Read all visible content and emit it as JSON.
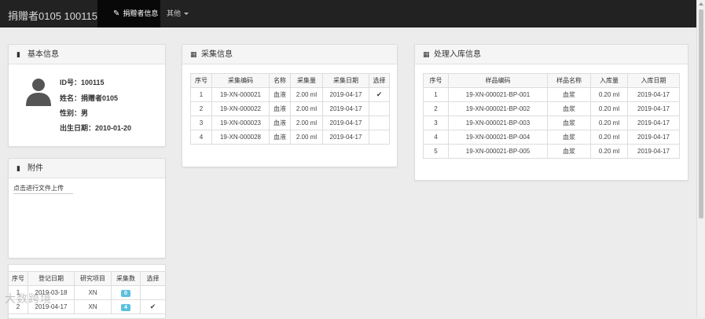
{
  "navbar": {
    "brand": "捐赠者0105 100115",
    "active_tab": "捐赠者信息",
    "other_tab": "其他"
  },
  "basic_info": {
    "title": "基本信息",
    "id_line": "ID号：100115",
    "name_line": "姓名：捐赠者0105",
    "gender_line": "性别：男",
    "birth_line": "出生日期：2010-01-20"
  },
  "attachment": {
    "title": "附件",
    "upload_label": "点击进行文件上传"
  },
  "registration_table": {
    "headers": [
      "序号",
      "登记日期",
      "研究项目",
      "采集数",
      "选择"
    ],
    "rows": [
      {
        "no": "1",
        "date": "2019-03-18",
        "project": "XN",
        "count": "0",
        "selected": ""
      },
      {
        "no": "2",
        "date": "2019-04-17",
        "project": "XN",
        "count": "4",
        "selected": "✔"
      }
    ]
  },
  "collection": {
    "title": "采集信息",
    "headers": [
      "序号",
      "采集编码",
      "名称",
      "采集量",
      "采集日期",
      "选择"
    ],
    "rows": [
      {
        "no": "1",
        "code": "19-XN-000021",
        "name": "血液",
        "amount": "2.00 ml",
        "date": "2019-04-17",
        "selected": "✔"
      },
      {
        "no": "2",
        "code": "19-XN-000022",
        "name": "血液",
        "amount": "2.00 ml",
        "date": "2019-04-17",
        "selected": ""
      },
      {
        "no": "3",
        "code": "19-XN-000023",
        "name": "血液",
        "amount": "2.00 ml",
        "date": "2019-04-17",
        "selected": ""
      },
      {
        "no": "4",
        "code": "19-XN-000028",
        "name": "血液",
        "amount": "2.00 ml",
        "date": "2019-04-17",
        "selected": ""
      }
    ]
  },
  "storage": {
    "title": "处理入库信息",
    "headers": [
      "序号",
      "样品编码",
      "样品名称",
      "入库量",
      "入库日期"
    ],
    "rows": [
      {
        "no": "1",
        "code": "19-XN-000021-BP-001",
        "name": "血浆",
        "amount": "0.20 ml",
        "date": "2019-04-17"
      },
      {
        "no": "2",
        "code": "19-XN-000021-BP-002",
        "name": "血浆",
        "amount": "0.20 ml",
        "date": "2019-04-17"
      },
      {
        "no": "3",
        "code": "19-XN-000021-BP-003",
        "name": "血浆",
        "amount": "0.20 ml",
        "date": "2019-04-17"
      },
      {
        "no": "4",
        "code": "19-XN-000021-BP-004",
        "name": "血浆",
        "amount": "0.20 ml",
        "date": "2019-04-17"
      },
      {
        "no": "5",
        "code": "19-XN-000021-BP-005",
        "name": "血浆",
        "amount": "0.20 ml",
        "date": "2019-04-17"
      }
    ]
  },
  "watermark": "大数跨境",
  "colors": {
    "navbar_bg": "#222222",
    "active_tab_bg": "#080808",
    "badge": "#5bc0de"
  }
}
